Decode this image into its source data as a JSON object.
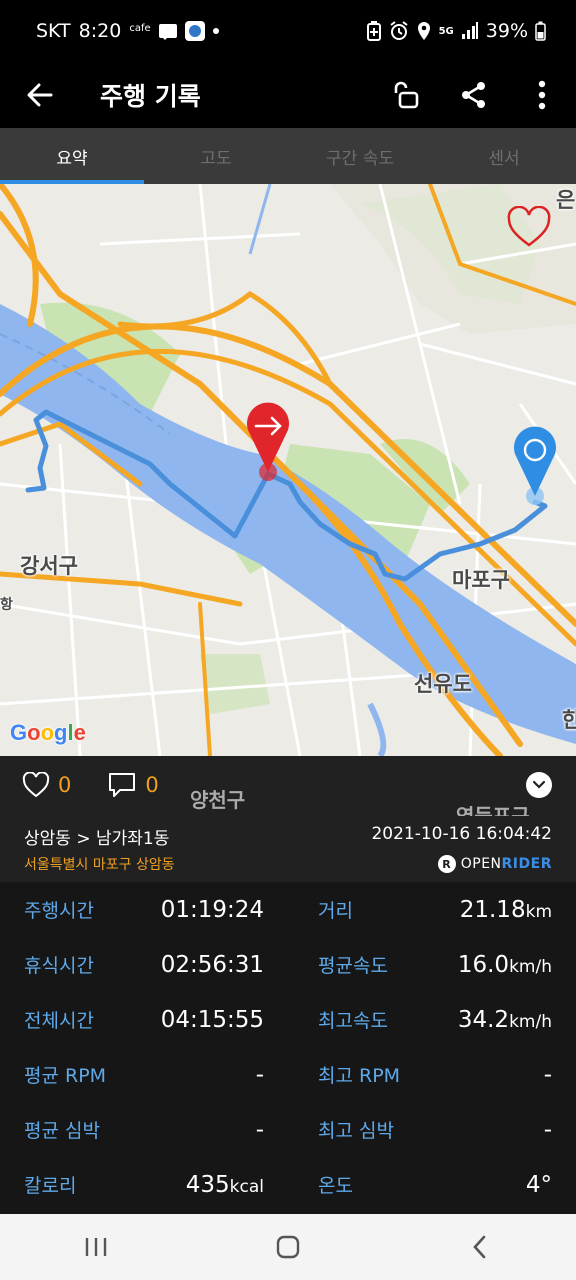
{
  "status_bar": {
    "carrier": "SKT",
    "time": "8:20",
    "cafe": "cafe",
    "network": "5G",
    "battery": "39%"
  },
  "app_bar": {
    "title": "주행 기록",
    "icons": [
      "arrow-left-icon",
      "unlock-icon",
      "share-icon",
      "more-vert-icon"
    ]
  },
  "tabs": [
    {
      "label": "요약",
      "active": true
    },
    {
      "label": "고도",
      "active": false
    },
    {
      "label": "구간 속도",
      "active": false
    },
    {
      "label": "센서",
      "active": false
    }
  ],
  "map": {
    "labels": {
      "gangseo": "강서구",
      "mapo": "마포구",
      "seonyudo": "선유도",
      "yangcheon": "양천구",
      "yeongdeungpo": "영등포구",
      "edge_top": "은",
      "edge_right": "한",
      "edge_left": "항"
    },
    "google": [
      "G",
      "o",
      "o",
      "g",
      "l",
      "e"
    ],
    "colors": {
      "route": "#4a8fdb",
      "start_marker": "#e0252b",
      "end_marker": "#2f8de4",
      "river": "#8fb6ee",
      "highway": "#f5a623"
    }
  },
  "social": {
    "likes": "0",
    "comments": "0"
  },
  "route": {
    "title": "상암동 > 남가좌1동",
    "datetime": "2021-10-16 16:04:42",
    "address": "서울특별시 마포구 상암동",
    "brand_open": "OPEN",
    "brand_rider": "RIDER",
    "brand_badge": "R"
  },
  "stats": [
    {
      "label": "주행시간",
      "value": "01:19:24",
      "unit": ""
    },
    {
      "label": "거리",
      "value": "21.18",
      "unit": "km"
    },
    {
      "label": "휴식시간",
      "value": "02:56:31",
      "unit": ""
    },
    {
      "label": "평균속도",
      "value": "16.0",
      "unit": "km/h"
    },
    {
      "label": "전체시간",
      "value": "04:15:55",
      "unit": ""
    },
    {
      "label": "최고속도",
      "value": "34.2",
      "unit": "km/h"
    },
    {
      "label": "평균 RPM",
      "value": "-",
      "unit": ""
    },
    {
      "label": "최고 RPM",
      "value": "-",
      "unit": ""
    },
    {
      "label": "평균 심박",
      "value": "-",
      "unit": ""
    },
    {
      "label": "최고 심박",
      "value": "-",
      "unit": ""
    },
    {
      "label": "칼로리",
      "value": "435",
      "unit": "kcal"
    },
    {
      "label": "온도",
      "value": "4°",
      "unit": ""
    }
  ]
}
